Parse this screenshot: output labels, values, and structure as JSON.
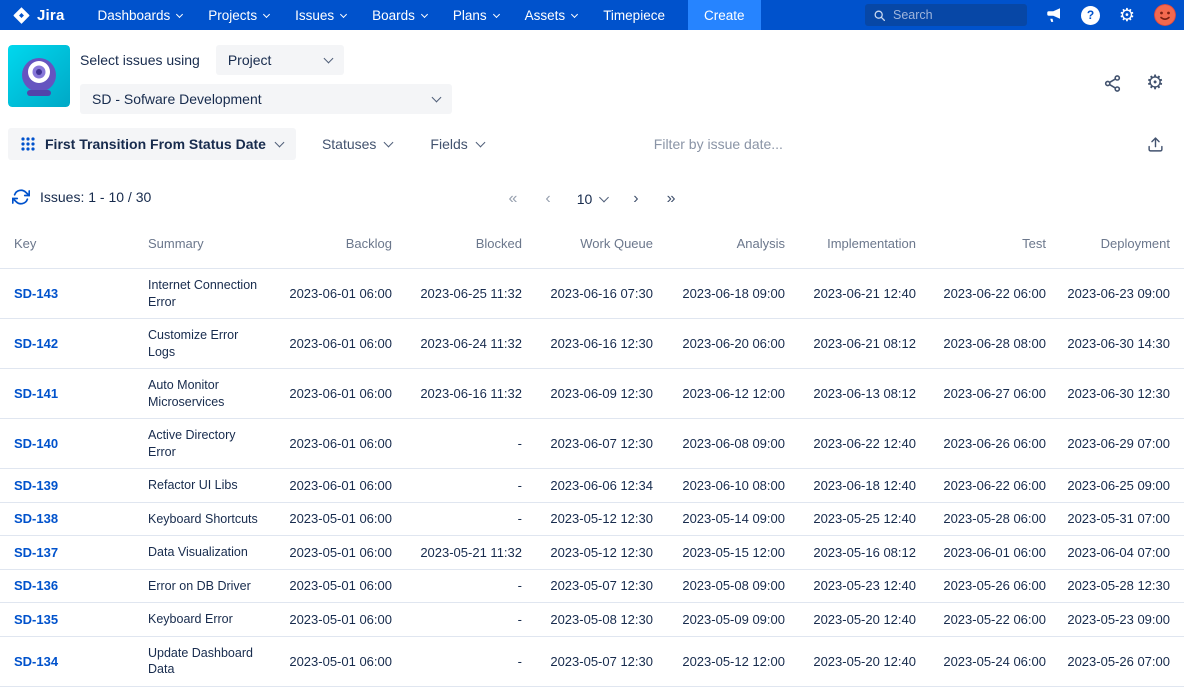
{
  "nav": {
    "brand": "Jira",
    "items": [
      {
        "label": "Dashboards",
        "chevron": true
      },
      {
        "label": "Projects",
        "chevron": true
      },
      {
        "label": "Issues",
        "chevron": true
      },
      {
        "label": "Boards",
        "chevron": true
      },
      {
        "label": "Plans",
        "chevron": true
      },
      {
        "label": "Assets",
        "chevron": true
      },
      {
        "label": "Timepiece",
        "chevron": false
      }
    ],
    "create_label": "Create",
    "search_placeholder": "Search",
    "icons": {
      "settings_glyph": "⚙",
      "help_glyph": "?"
    }
  },
  "header": {
    "select_issues_label": "Select issues using",
    "issue_source_value": "Project",
    "project_value": "SD - Sofware Development"
  },
  "toolbar": {
    "date_field_label": "First Transition From Status Date",
    "statuses_label": "Statuses",
    "fields_label": "Fields",
    "filter_placeholder": "Filter by issue date..."
  },
  "pagination": {
    "issues_count_label": "Issues: 1 - 10 / 30",
    "page_size_value": "10",
    "icons": {
      "first": "«",
      "prev": "‹",
      "next": "›",
      "last": "»"
    }
  },
  "table": {
    "columns": [
      "Key",
      "Summary",
      "Backlog",
      "Blocked",
      "Work Queue",
      "Analysis",
      "Implementation",
      "Test",
      "Deployment"
    ],
    "rows": [
      {
        "key": "SD-143",
        "summary": "Internet Connection Error",
        "dates": [
          "2023-06-01 06:00",
          "2023-06-25 11:32",
          "2023-06-16 07:30",
          "2023-06-18 09:00",
          "2023-06-21 12:40",
          "2023-06-22 06:00",
          "2023-06-23 09:00"
        ]
      },
      {
        "key": "SD-142",
        "summary": "Customize Error Logs",
        "dates": [
          "2023-06-01 06:00",
          "2023-06-24 11:32",
          "2023-06-16 12:30",
          "2023-06-20 06:00",
          "2023-06-21 08:12",
          "2023-06-28 08:00",
          "2023-06-30 14:30"
        ]
      },
      {
        "key": "SD-141",
        "summary": "Auto Monitor Microservices",
        "dates": [
          "2023-06-01 06:00",
          "2023-06-16 11:32",
          "2023-06-09 12:30",
          "2023-06-12 12:00",
          "2023-06-13 08:12",
          "2023-06-27 06:00",
          "2023-06-30 12:30"
        ]
      },
      {
        "key": "SD-140",
        "summary": "Active Directory Error",
        "dates": [
          "2023-06-01 06:00",
          "-",
          "2023-06-07 12:30",
          "2023-06-08 09:00",
          "2023-06-22 12:40",
          "2023-06-26 06:00",
          "2023-06-29 07:00"
        ]
      },
      {
        "key": "SD-139",
        "summary": "Refactor UI Libs",
        "dates": [
          "2023-06-01 06:00",
          "-",
          "2023-06-06 12:34",
          "2023-06-10 08:00",
          "2023-06-18 12:40",
          "2023-06-22 06:00",
          "2023-06-25 09:00"
        ]
      },
      {
        "key": "SD-138",
        "summary": "Keyboard Shortcuts",
        "dates": [
          "2023-05-01 06:00",
          "-",
          "2023-05-12 12:30",
          "2023-05-14 09:00",
          "2023-05-25 12:40",
          "2023-05-28 06:00",
          "2023-05-31 07:00"
        ]
      },
      {
        "key": "SD-137",
        "summary": "Data Visualization",
        "dates": [
          "2023-05-01 06:00",
          "2023-05-21 11:32",
          "2023-05-12 12:30",
          "2023-05-15 12:00",
          "2023-05-16 08:12",
          "2023-06-01 06:00",
          "2023-06-04 07:00"
        ]
      },
      {
        "key": "SD-136",
        "summary": "Error on DB Driver",
        "dates": [
          "2023-05-01 06:00",
          "-",
          "2023-05-07 12:30",
          "2023-05-08 09:00",
          "2023-05-23 12:40",
          "2023-05-26 06:00",
          "2023-05-28 12:30"
        ]
      },
      {
        "key": "SD-135",
        "summary": "Keyboard Error",
        "dates": [
          "2023-05-01 06:00",
          "-",
          "2023-05-08 12:30",
          "2023-05-09 09:00",
          "2023-05-20 12:40",
          "2023-05-22 06:00",
          "2023-05-23 09:00"
        ]
      },
      {
        "key": "SD-134",
        "summary": "Update Dashboard Data",
        "dates": [
          "2023-05-01 06:00",
          "-",
          "2023-05-07 12:30",
          "2023-05-12 12:00",
          "2023-05-20 12:40",
          "2023-05-24 06:00",
          "2023-05-26 07:00"
        ]
      }
    ]
  },
  "colors": {
    "nav_background": "#0052CC",
    "create_button": "#2684FF",
    "link": "#0052CC",
    "app_icon_teal": "#00C7E4",
    "app_icon_purple": "#6554C0",
    "text_primary": "#172B4D",
    "text_muted": "#6B778C",
    "row_divider": "#E0E6F0",
    "control_background": "#F4F5F7"
  }
}
